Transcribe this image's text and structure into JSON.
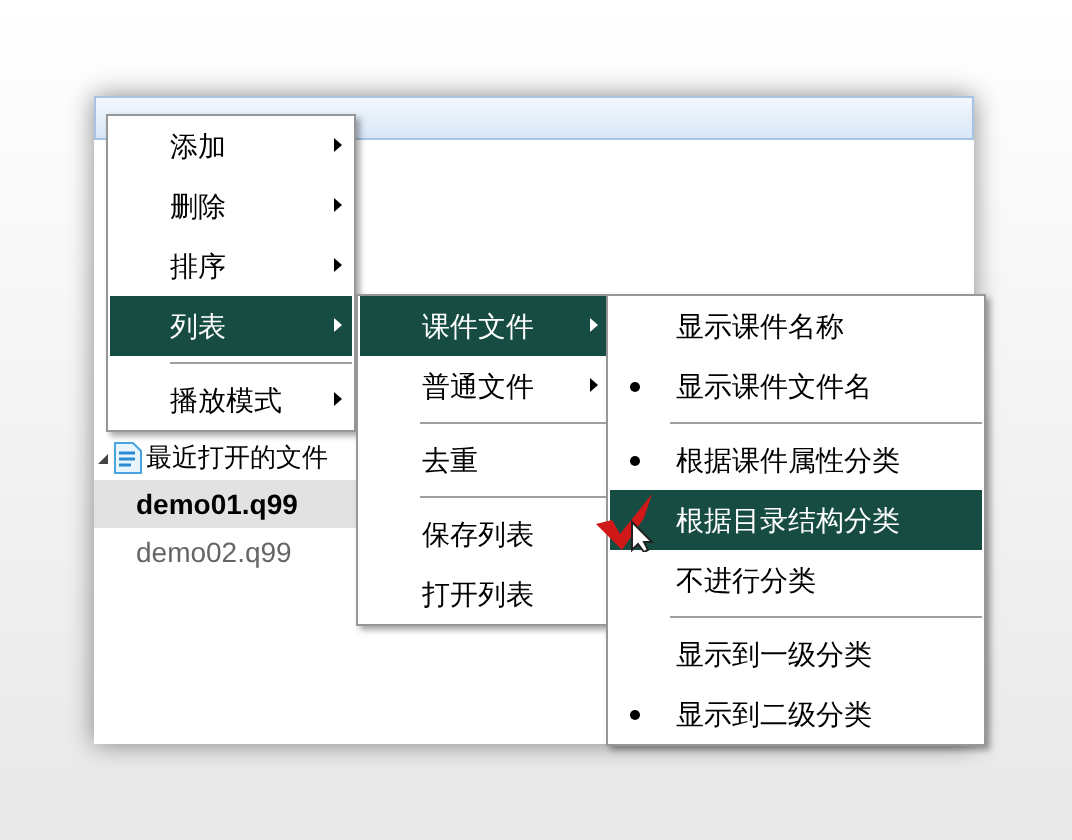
{
  "tree": {
    "items": [
      {
        "label": "最近打开的文件",
        "expanded": true,
        "children": [
          {
            "label": "demo01.q99",
            "selected": true
          },
          {
            "label": "demo02.q99",
            "selected": false
          }
        ]
      }
    ]
  },
  "menus": [
    {
      "items": [
        {
          "kind": "item",
          "label": "添加",
          "submenu": true,
          "selected": false
        },
        {
          "kind": "item",
          "label": "删除",
          "submenu": true,
          "selected": false
        },
        {
          "kind": "item",
          "label": "排序",
          "submenu": true,
          "selected": false
        },
        {
          "kind": "item",
          "label": "列表",
          "submenu": true,
          "selected": true
        },
        {
          "kind": "separator"
        },
        {
          "kind": "item",
          "label": "播放模式",
          "submenu": true,
          "selected": false
        }
      ]
    },
    {
      "items": [
        {
          "kind": "item",
          "label": "课件文件",
          "submenu": true,
          "selected": true
        },
        {
          "kind": "item",
          "label": "普通文件",
          "submenu": true,
          "selected": false
        },
        {
          "kind": "separator"
        },
        {
          "kind": "item",
          "label": "去重",
          "submenu": false,
          "selected": false
        },
        {
          "kind": "separator"
        },
        {
          "kind": "item",
          "label": "保存列表",
          "submenu": false,
          "selected": false
        },
        {
          "kind": "item",
          "label": "打开列表",
          "submenu": false,
          "selected": false
        }
      ]
    },
    {
      "items": [
        {
          "kind": "item",
          "label": "显示课件名称",
          "checked": false,
          "selected": false
        },
        {
          "kind": "item",
          "label": "显示课件文件名",
          "checked": true,
          "selected": false
        },
        {
          "kind": "separator"
        },
        {
          "kind": "item",
          "label": "根据课件属性分类",
          "checked": true,
          "selected": false
        },
        {
          "kind": "item",
          "label": "根据目录结构分类",
          "checked": false,
          "selected": true
        },
        {
          "kind": "item",
          "label": "不进行分类",
          "checked": false,
          "selected": false
        },
        {
          "kind": "separator"
        },
        {
          "kind": "item",
          "label": "显示到一级分类",
          "checked": false,
          "selected": false
        },
        {
          "kind": "item",
          "label": "显示到二级分类",
          "checked": true,
          "selected": false
        }
      ]
    }
  ]
}
